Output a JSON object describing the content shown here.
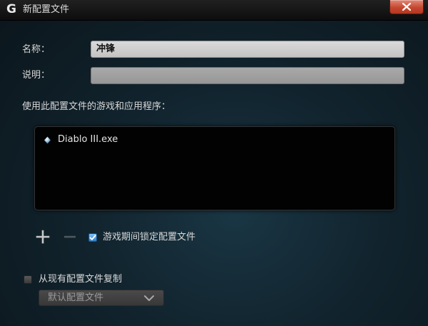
{
  "window": {
    "title": "新配置文件",
    "logo_glyph": "G"
  },
  "form": {
    "name_label": "名称：",
    "name_value": "冲锋",
    "description_label": "说明：",
    "description_value": ""
  },
  "apps": {
    "section_label": "使用此配置文件的游戏和应用程序：",
    "items": [
      {
        "name": "Diablo III.exe",
        "icon": "app-bullet-icon"
      }
    ]
  },
  "controls": {
    "add_icon": "plus-icon",
    "remove_icon": "minus-icon",
    "lock_label": "游戏期间锁定配置文件",
    "lock_checked": true
  },
  "copy": {
    "label": "从现有配置文件复制",
    "checked": false,
    "dropdown_value": "默认配置文件"
  },
  "colors": {
    "accent_checkbox": "#3f8fd8",
    "close_button": "#c6472f",
    "background": "#11232d"
  }
}
